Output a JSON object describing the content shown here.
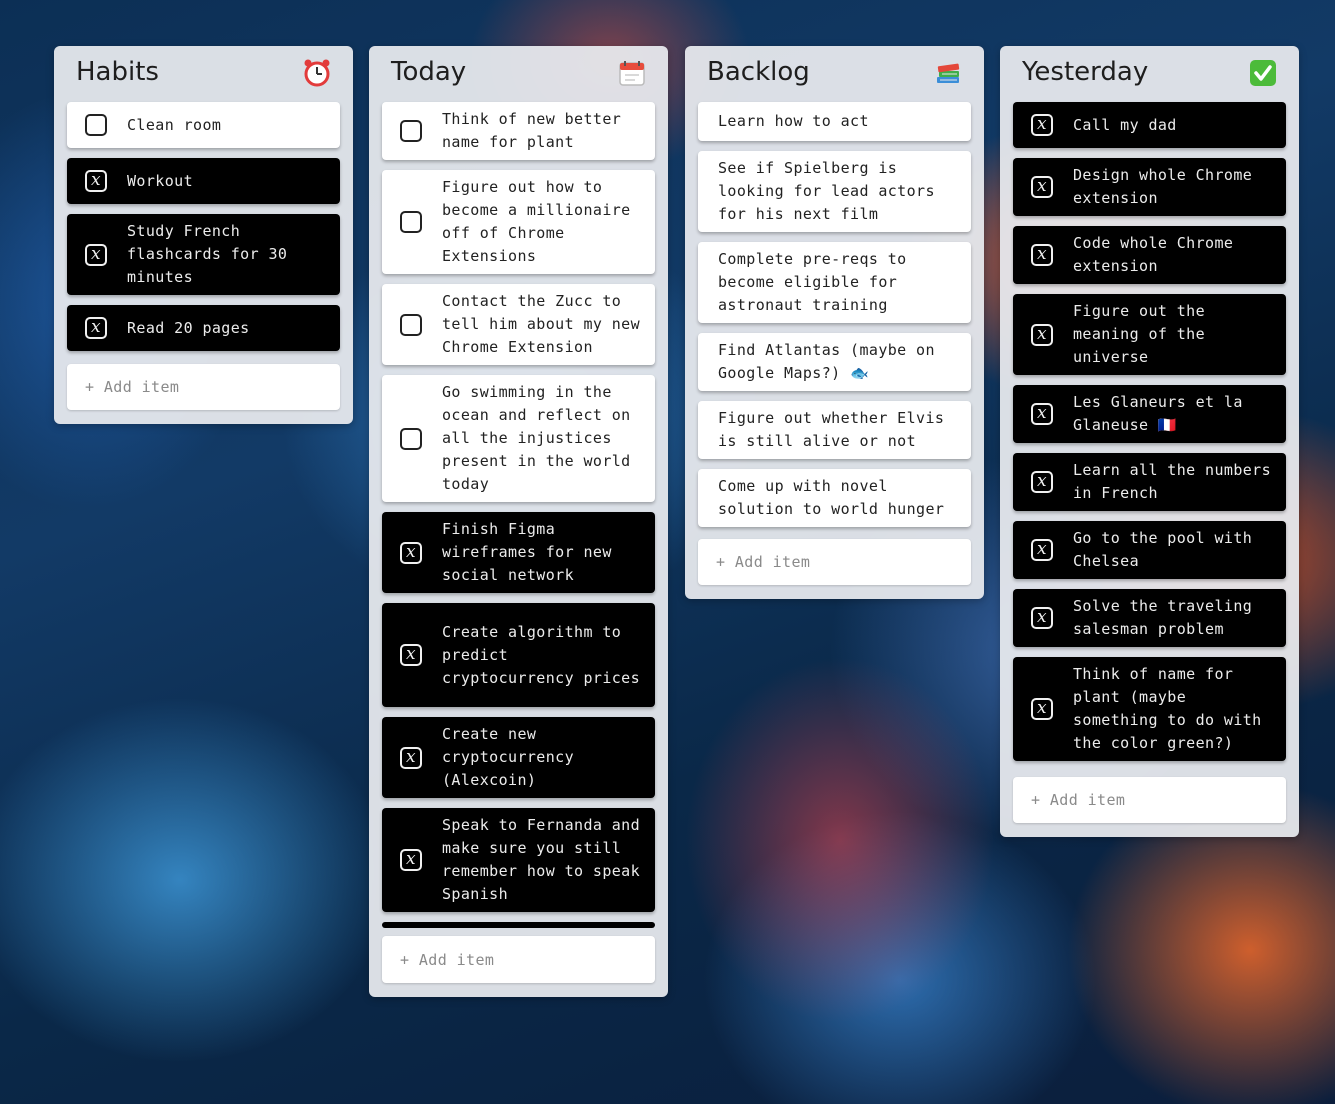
{
  "columns": [
    {
      "title": "Habits",
      "icon": "alarm-clock-icon",
      "add_label": "+ Add item",
      "items": [
        {
          "text": "Clean room",
          "done": false
        },
        {
          "text": "Workout",
          "done": true
        },
        {
          "text": "Study French flashcards for 30 minutes",
          "done": true
        },
        {
          "text": "Read 20 pages",
          "done": true
        }
      ]
    },
    {
      "title": "Today",
      "icon": "calendar-icon",
      "add_label": "+ Add item",
      "items": [
        {
          "text": "Think of new better name for plant",
          "done": false
        },
        {
          "text": "Figure out how to become a millionaire off of Chrome Extensions",
          "done": false
        },
        {
          "text": "Contact the Zucc to tell him about my new Chrome Extension",
          "done": false
        },
        {
          "text": "Go swimming in the ocean and reflect on all the injustices present in the world today",
          "done": false
        },
        {
          "text": "Finish Figma wireframes for new social network",
          "done": true
        },
        {
          "text": "Create algorithm to predict cryptocurrency prices",
          "done": true
        },
        {
          "text": "Create new cryptocurrency (Alexcoin)",
          "done": true
        },
        {
          "text": "Speak to Fernanda and make sure you still remember how to speak Spanish",
          "done": true
        }
      ]
    },
    {
      "title": "Backlog",
      "icon": "books-icon",
      "add_label": "+ Add item",
      "items": [
        {
          "text": "Learn how to act",
          "done": null
        },
        {
          "text": "See if Spielberg is looking for lead actors for his next film",
          "done": null
        },
        {
          "text": "Complete pre-reqs to become eligible for astronaut training",
          "done": null
        },
        {
          "text": "Find Atlantas (maybe on Google Maps?) 🐟",
          "done": null
        },
        {
          "text": "Figure out whether Elvis is still alive or not",
          "done": null
        },
        {
          "text": "Come up with novel solution to world hunger",
          "done": null
        }
      ]
    },
    {
      "title": "Yesterday",
      "icon": "check-mark-icon",
      "add_label": "+ Add item",
      "items": [
        {
          "text": "Call my dad",
          "done": true
        },
        {
          "text": "Design whole Chrome extension",
          "done": true
        },
        {
          "text": "Code whole Chrome extension",
          "done": true
        },
        {
          "text": "Figure out the meaning of the universe",
          "done": true
        },
        {
          "text": "Les Glaneurs et la Glaneuse 🇫🇷",
          "done": true
        },
        {
          "text": "Learn all the numbers in French",
          "done": true
        },
        {
          "text": "Go to the pool with Chelsea",
          "done": true
        },
        {
          "text": "Solve the traveling salesman problem",
          "done": true
        },
        {
          "text": "Think of name for plant (maybe something to do with the color green?)",
          "done": true
        }
      ]
    }
  ]
}
